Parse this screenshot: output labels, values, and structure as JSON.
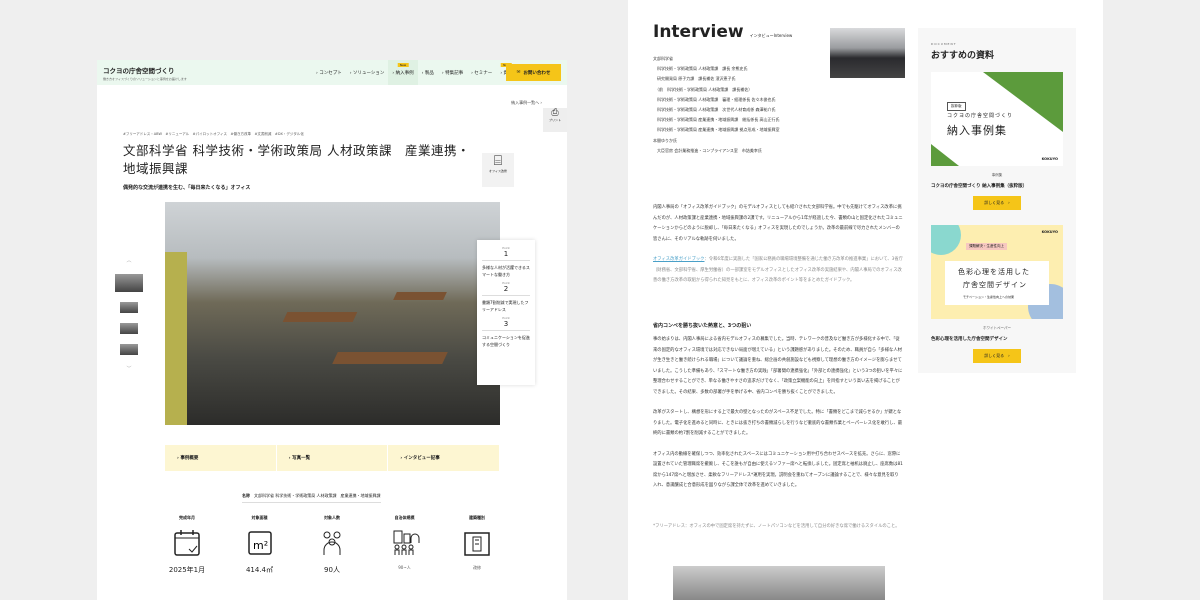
{
  "left": {
    "brand": {
      "title": "コクヨの庁舎空間づくり",
      "subtitle": "働き方オフィスづくりのソリューションと事例をお届けします"
    },
    "nav": [
      {
        "label": "› コンセプト"
      },
      {
        "label": "› ソリューション"
      },
      {
        "label": "› 納入事例",
        "badge": "New"
      },
      {
        "label": "› 製品"
      },
      {
        "label": "› 特集記事"
      },
      {
        "label": "› セミナー"
      },
      {
        "label": "› 資料",
        "badge": "New"
      }
    ],
    "contact": "お問い合わせ",
    "back_link": "納入事例一覧へ ›",
    "print": "プリント",
    "tags": "#フリーアドレス・ABW　#リニューアル　#パイロットオフィス　#働き方改革　#文書削減　#DX・デジタル化",
    "title_line1": "文部科学省 科学技術・学術政策局 人材政策課　産業連携・",
    "title_line2": "地域振興課",
    "subtitle": "偶発的な交流が連携を生む、「毎日来たくなる」オフィス",
    "office_type": "オフィス改修",
    "points": [
      {
        "label": "Point",
        "num": "1",
        "text": "多様な人材が活躍できるスマートな働き方"
      },
      {
        "label": "Point",
        "num": "2",
        "text": "書類7割削減で実現したフリーアドレス"
      },
      {
        "label": "Point",
        "num": "3",
        "text": "コミュニケーションを促進する空間づくり"
      }
    ],
    "tabs": [
      "› 事例概要",
      "› 写真一覧",
      "› インタビュー記事"
    ],
    "name_label": "名称",
    "name_value": "文部科学省 科学技術・学術政策局 人材政策課　産業連携・地域振興課",
    "stats": [
      {
        "label": "完成年月",
        "value": "2025年1月"
      },
      {
        "label": "対象面積",
        "value": "414.4㎡"
      },
      {
        "label": "対象人数",
        "value": "90人"
      },
      {
        "label": "自治体規模",
        "value": "90~人"
      },
      {
        "label": "建築種別",
        "value": "改修"
      }
    ]
  },
  "right": {
    "heading": "Interview",
    "heading_sub": "インタビューInterview",
    "people": [
      "文部科学省",
      "　科学技術・学術政策局 人材政策課　課長 余熊史氏",
      "　研究開発局 原子力課　課長補佐 濱沢恵子氏",
      "　（前　科学技術・学術政策局 人材政策課　課長補佐）",
      "　科学技術・学術政策局 人材政策課　審理・経理係長 佐々木俊也氏",
      "　科学技術・学術政策局 人材政策課　次世代人材育成係 森澤祐介氏",
      "　科学技術・学術政策局 産業連携・地域振興課　総括係長 高山正行氏",
      "　科学技術・学術政策局 産業連携・地域振興課 拠点形成・地域振興室",
      "本間ゆりか氏",
      "　大臣官房 会計業務推進・コンプライアンス室　市詰美幸氏"
    ],
    "intro": "内閣人事局の「オフィス改革ガイドブック」のモデルオフィスとしても紹介された文部科学省。中でも先駆けてオフィス改革に挑んだのが、人材政策課と産業連携・地域振興課の2課です。リニューアルから1年が経過した今、書類の山と固定化されたコミュニケーションからどのように脱却し、「毎日来たくなる」オフィスを実現したのでしょうか。改革の最前線で尽力されたメンバーの皆さんに、そのリアルな軌跡を伺いました。",
    "note_link": "オフィス改革ガイドブック",
    "note": "：令和6年度に実施した「国家公務員の職場環境整備を通じた働き方改革の推進事業」において、3省庁（財務省、文部科学省、厚生労働省）の一部課室をモデルオフィスとしたオフィス改革の実施結果や、内閣人事局でのオフィス改善の働き方改革の取組から得られた知見をもとに、オフィス改革のポイント等をまとめたガイドブック。",
    "section_title": "省内コンペを勝ち抜いた熱意と、3つの狙い",
    "paragraphs": [
      "事の始まりは、内閣人事局による省内モデルオフィスの募集でした。当時、テレワークの普及など働き方が多様化する中で、「従来の固定的なオフィス環境では対応できない局面が増えている」という課題感がありました。そのため、職員が自ら「多様な人材が生き生きと働き続けられる職場」について議論を重ね、総企画の共創施設なども視察して理想の働き方のイメージを膨らませていました。こうした準備もあり、「スマートな働き方の実践」「部署間の連携強化」「外部との連携強化」という3つの狙いを平々に整理合わせすることができ、単なる働きやすさの追求だけでなく、「政策立案機能の向上」を目指すという高い志を掲げることができました。その結果、多数の部署が手を挙げる中、省内コンペを勝ち抜くことができました。",
      "改革がスタートし、構想を形にする上で最大の壁となったのがスペース不足でした。特に「書類をどこまで減らせるか」が鍵となりました。電子化を進めると同時に、ときには抜き打ちの書類減らしを行うなど徹底的な書類作業とペーパーレス化を敢行し、最終的に書類の約7割を削減することができました。",
      "オフィス内の動線を確保しつつ、効率化されたスペースにはコミュニケーション用や打ち合わせスペースを拡充。さらに、窓際に設置されていた管理職席を撤廃し、そこを誰もが自由に使えるソファー席へと転換しました。固定席と袖机は廃止し、座席数は81席から147席へと増加させ、柔軟なフリーアドレス*運用を実現。説明会を重ねてオープンに議論することで、様々な意見を取り入れ、意識醸成と合意形成を図りながら課全体で改革を進めていきました。"
    ],
    "footnote": "*フリーアドレス：オフィスの中で固定席を持たずに、ノートパソコンなどを活用して自分の好きな席で働けるスタイルのこと。",
    "sidebar": {
      "eyebrow": "DOCUMENT",
      "title": "おすすめの資料",
      "docs": [
        {
          "cover_badge": "抜粋版",
          "cover_line1": "コクヨの庁舎空間づくり",
          "cover_line2": "納入事例集",
          "cover_brand": "KOKUYO",
          "category": "事例集",
          "title": "コクヨの庁舎空間づくり 納入事例集（抜粋版）",
          "button": "詳しく見る　›"
        },
        {
          "cover_badge": "課題解決・生産性向上",
          "cover_line1": "色彩心理を活用した",
          "cover_line2": "庁舎空間デザイン",
          "cover_sub": "モチベーション・生産性向上への効果",
          "cover_brand": "KOKUYO",
          "category": "ホワイトペーパー",
          "title": "色彩心理を活用した庁舎空間デザイン",
          "button": "詳しく見る　›"
        }
      ]
    }
  }
}
